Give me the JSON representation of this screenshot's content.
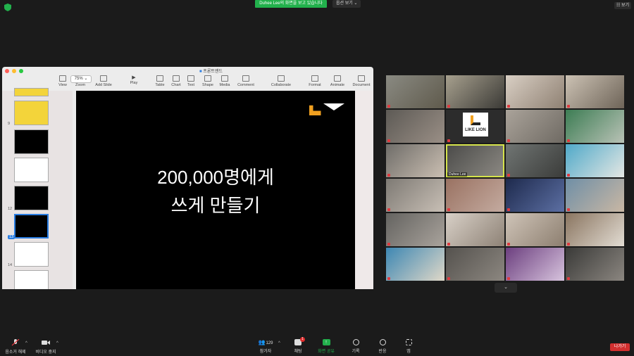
{
  "topbar": {
    "share_banner": "Duhee Lee의 화면을 보고 있습니다",
    "view_options": "옵션 보기 ⌄",
    "view_button": "보기"
  },
  "keynote": {
    "window_title": "프론트엔드",
    "zoom": "75% ⌄",
    "toolbar": {
      "view": "View",
      "zoom": "Zoom",
      "add_slide": "Add Slide",
      "play": "Play",
      "table": "Table",
      "chart": "Chart",
      "text": "Text",
      "shape": "Shape",
      "media": "Media",
      "comment": "Comment",
      "collaborate": "Collaborate",
      "format": "Format",
      "animate": "Animate",
      "document": "Document"
    },
    "slide_numbers": [
      "9",
      "12",
      "13",
      "14"
    ],
    "slide": {
      "line1": "200,000명에게",
      "line2": "쓰게 만들기"
    }
  },
  "video_grid": {
    "names": [
      "Duhee Lee"
    ],
    "logo_text": "LIKE LION",
    "collapse": "⌄"
  },
  "bottombar": {
    "unmute": "음소거 해제",
    "start_video": "비디오 중지",
    "participants": "참가자",
    "participants_count": "129",
    "chat": "채팅",
    "chat_badge": "1",
    "share_screen": "화면 공유",
    "record": "기록",
    "reactions": "반응",
    "apps": "앱",
    "leave": "나가기"
  },
  "colors": {
    "share_green": "#22b14c",
    "leave_red": "#d22f2f",
    "active_speaker": "#d6e44b",
    "slide_bg": "#000000",
    "accent_orange": "#f0a020"
  }
}
